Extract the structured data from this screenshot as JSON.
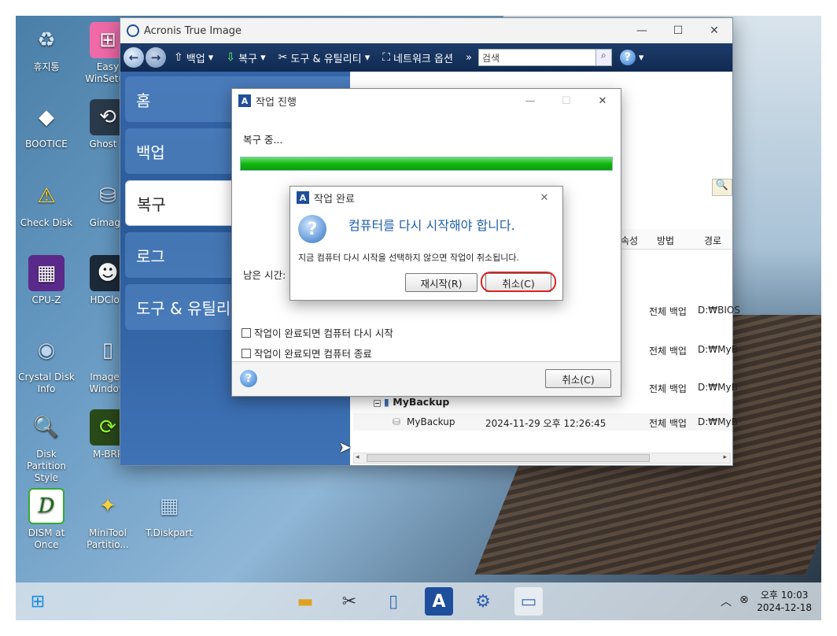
{
  "desktop": {
    "icons": [
      {
        "label": "휴지통",
        "icon": "recycle-bin-icon"
      },
      {
        "label": "Easy WinSetup",
        "icon": "windows-setup-icon"
      },
      {
        "label": "BOOTICE",
        "icon": "bootice-icon"
      },
      {
        "label": "Ghost R",
        "icon": "ghost-icon"
      },
      {
        "label": "Check Disk",
        "icon": "check-disk-icon"
      },
      {
        "label": "Gimage",
        "icon": "gimage-icon"
      },
      {
        "label": "CPU-Z",
        "icon": "cpu-icon"
      },
      {
        "label": "HDClon",
        "icon": "hdclone-icon"
      },
      {
        "label": "Crystal Disk Info",
        "icon": "crystal-disk-icon"
      },
      {
        "label": "Image f Window",
        "icon": "image-windows-icon"
      },
      {
        "label": "Disk Partition Style",
        "icon": "disk-partition-icon"
      },
      {
        "label": "M-BRP",
        "icon": "mbr-icon"
      },
      {
        "label": "DISM at Once",
        "icon": "dism-icon"
      },
      {
        "label": "MiniTool Partitio...",
        "icon": "minitool-icon"
      },
      {
        "label": "T.Diskpart",
        "icon": "diskpart-icon"
      }
    ]
  },
  "acronis": {
    "title": "Acronis True Image",
    "toolbar": {
      "backup": "백업",
      "restore": "복구",
      "tools": "도구 & 유틸리티",
      "network": "네트워크 옵션",
      "more": "»",
      "search_placeholder": "검색"
    },
    "sidebar": [
      "홈",
      "백업",
      "복구",
      "로그",
      "도구 & 유틸리"
    ],
    "table": {
      "headers": [
        "속성",
        "방법",
        "경로"
      ],
      "rows": [
        {
          "method": "전체 백업",
          "path": "D:₩BIOS"
        },
        {
          "method": "전체 백업",
          "path": "D:₩MyB"
        },
        {
          "method": "전체 백업",
          "path": "D:₩MyB"
        },
        {
          "name": "MyBackup",
          "date": "2024-11-29 오후 12:26:45",
          "method": "전체 백업",
          "path": "D:₩MyB"
        }
      ],
      "group": "MyBackup"
    }
  },
  "progress_dialog": {
    "title": "작업 진행",
    "status": "복구 중...",
    "progress": 1.0,
    "remaining_label": "남은 시간:",
    "check_restart": "작업이 완료되면 컴퓨터 다시 시작",
    "check_shutdown": "작업이 완료되면 컴퓨터 종료",
    "cancel": "취소(C)"
  },
  "done_dialog": {
    "title": "작업 완료",
    "heading": "컴퓨터를 다시 시작해야 합니다.",
    "message": "지금 컴퓨터 다시 시작을 선택하지 않으면 작업이 취소됩니다.",
    "restart": "재시작(R)",
    "cancel": "취소(C)"
  },
  "taskbar": {
    "time": "오후 10:03",
    "date": "2024-12-18"
  },
  "colors": {
    "toolbar": "#0f2a52",
    "progress": "#13b813",
    "highlight": "#dd2222",
    "heading": "#1f5fa8"
  }
}
